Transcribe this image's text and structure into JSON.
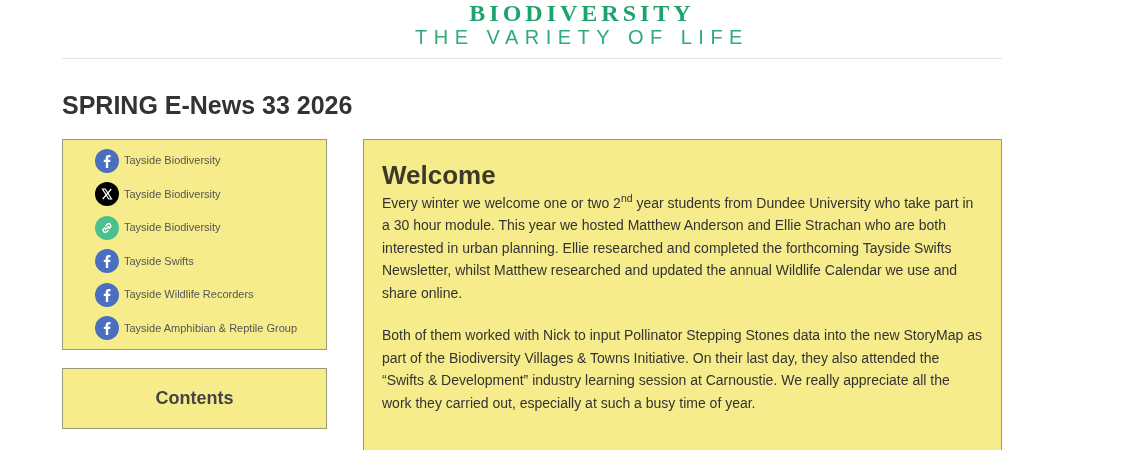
{
  "logo": {
    "name": "BIODIVERSITY",
    "tagline": "THE VARIETY OF LIFE"
  },
  "title": "SPRING E-News 33 2026",
  "social_links": [
    {
      "kind": "facebook",
      "label": "Tayside Biodiversity"
    },
    {
      "kind": "x",
      "label": "Tayside Biodiversity"
    },
    {
      "kind": "link",
      "label": "Tayside Biodiversity"
    },
    {
      "kind": "facebook",
      "label": "Tayside Swifts"
    },
    {
      "kind": "facebook",
      "label": "Tayside Wildlife Recorders"
    },
    {
      "kind": "facebook",
      "label": "Tayside Amphibian & Reptile Group"
    }
  ],
  "contents": {
    "heading": "Contents"
  },
  "article": {
    "heading": "Welcome",
    "paragraphs": [
      "Every winter we welcome one or two 2$^{nd}$ year students from Dundee University who take part in a 30 hour module. This year we hosted Matthew Anderson and Ellie Strachan who are both interested in urban planning. Ellie researched and completed the forthcoming Tayside Swifts Newsletter, whilst Matthew researched and updated the annual Wildlife Calendar we use and share online.",
      "Both of them worked with Nick to input Pollinator Stepping Stones data into the new StoryMap as part of the Biodiversity Villages & Towns Initiative. On their last day, they also attended the “Swifts & Development” industry learning session at Carnoustie. We really appreciate all the work they carried out, especially at such a busy time of year."
    ]
  }
}
